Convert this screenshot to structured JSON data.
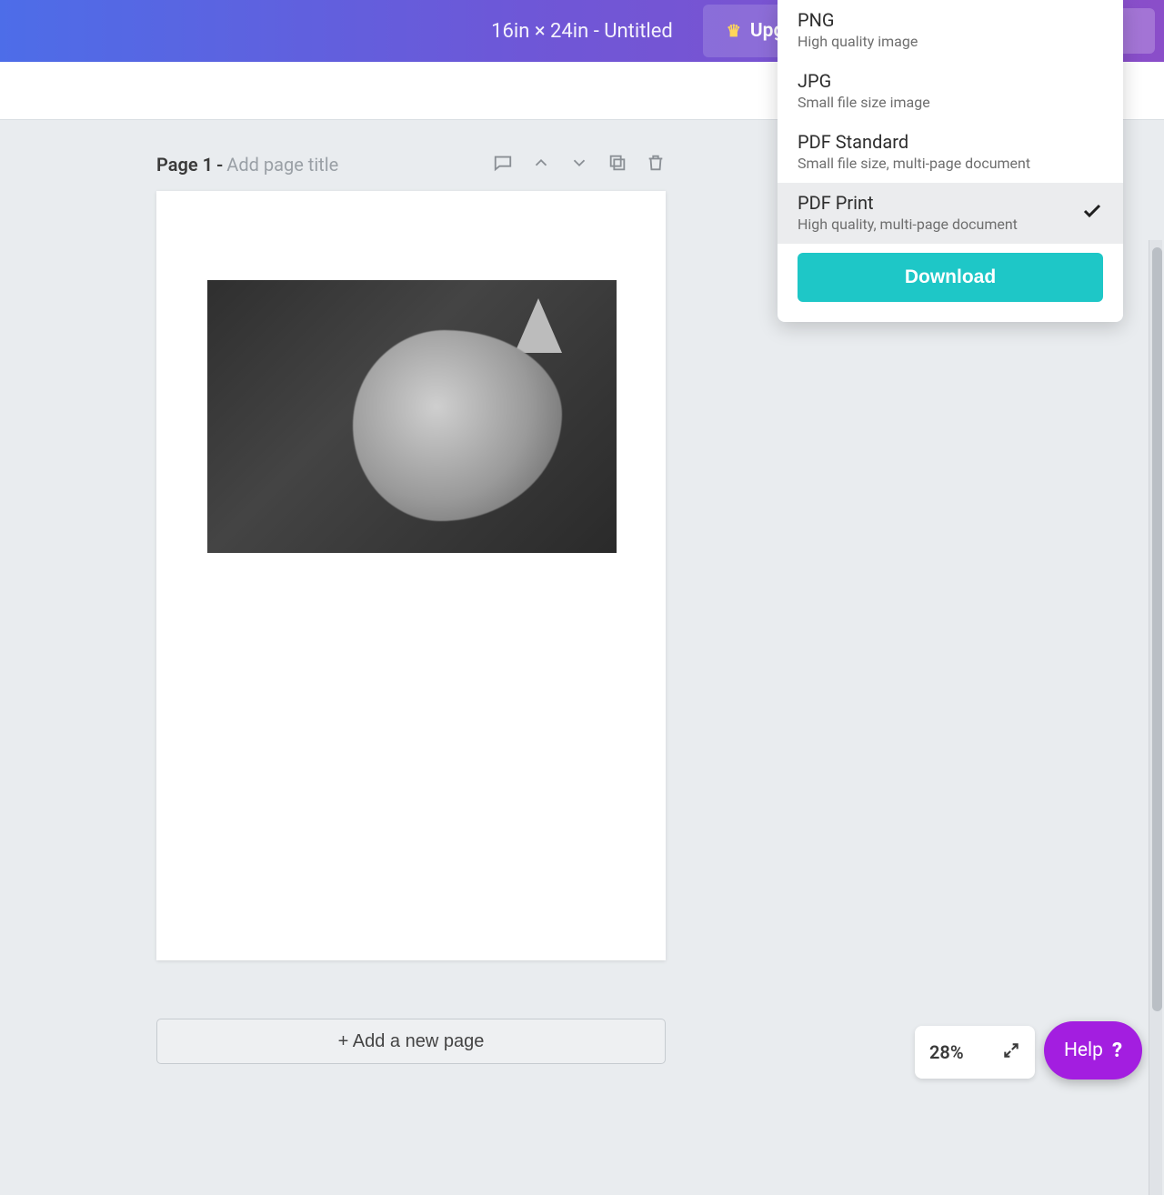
{
  "header": {
    "doc_title": "16in × 24in - Untitled",
    "upgrade_label": "Upgrade"
  },
  "page": {
    "label": "Page 1",
    "separator": "-",
    "title_placeholder": "Add page title",
    "image_alt": "dog-photo"
  },
  "download_menu": {
    "options": [
      {
        "title": "PNG",
        "desc": "High quality image",
        "selected": false
      },
      {
        "title": "JPG",
        "desc": "Small file size image",
        "selected": false
      },
      {
        "title": "PDF Standard",
        "desc": "Small file size, multi-page document",
        "selected": false
      },
      {
        "title": "PDF Print",
        "desc": "High quality, multi-page document",
        "selected": true
      }
    ],
    "download_label": "Download"
  },
  "add_page_label": "+ Add a new page",
  "zoom": {
    "value": "28%"
  },
  "help": {
    "label": "Help",
    "q": "?"
  }
}
